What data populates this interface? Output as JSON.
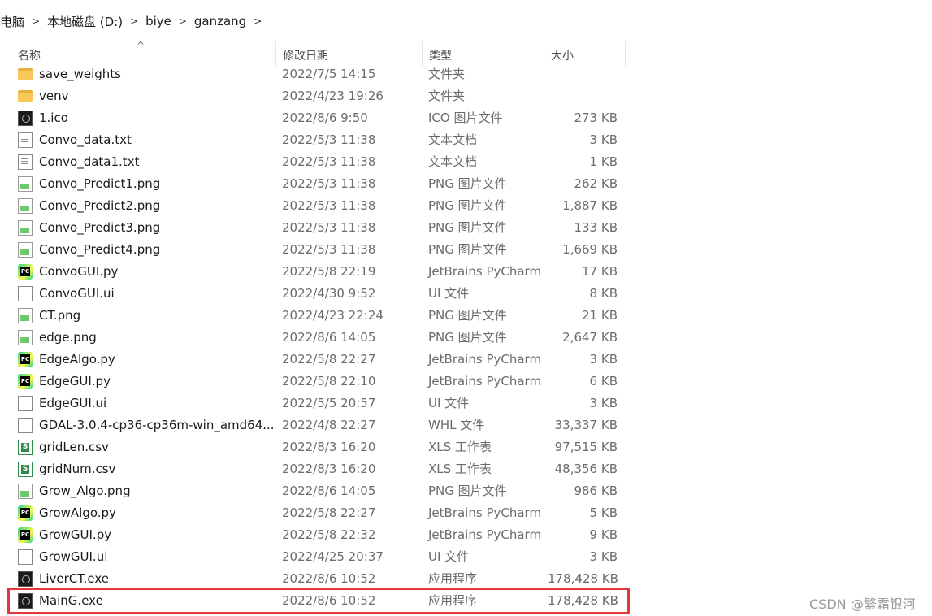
{
  "breadcrumb": {
    "items": [
      "电脑",
      "本地磁盘 (D:)",
      "biye",
      "ganzang"
    ]
  },
  "columns": {
    "name": "名称",
    "date": "修改日期",
    "type": "类型",
    "size": "大小"
  },
  "files": [
    {
      "icon": "folder-icon",
      "name": "save_weights",
      "date": "2022/7/5 14:15",
      "type": "文件夹",
      "size": ""
    },
    {
      "icon": "folder-icon",
      "name": "venv",
      "date": "2022/4/23 19:26",
      "type": "文件夹",
      "size": ""
    },
    {
      "icon": "ico-file-icon",
      "name": "1.ico",
      "date": "2022/8/6 9:50",
      "type": "ICO 图片文件",
      "size": "273 KB"
    },
    {
      "icon": "text-file-icon",
      "name": "Convo_data.txt",
      "date": "2022/5/3 11:38",
      "type": "文本文档",
      "size": "3 KB"
    },
    {
      "icon": "text-file-icon",
      "name": "Convo_data1.txt",
      "date": "2022/5/3 11:38",
      "type": "文本文档",
      "size": "1 KB"
    },
    {
      "icon": "png-file-icon",
      "name": "Convo_Predict1.png",
      "date": "2022/5/3 11:38",
      "type": "PNG 图片文件",
      "size": "262 KB"
    },
    {
      "icon": "png-file-icon",
      "name": "Convo_Predict2.png",
      "date": "2022/5/3 11:38",
      "type": "PNG 图片文件",
      "size": "1,887 KB"
    },
    {
      "icon": "png-file-icon",
      "name": "Convo_Predict3.png",
      "date": "2022/5/3 11:38",
      "type": "PNG 图片文件",
      "size": "133 KB"
    },
    {
      "icon": "png-file-icon",
      "name": "Convo_Predict4.png",
      "date": "2022/5/3 11:38",
      "type": "PNG 图片文件",
      "size": "1,669 KB"
    },
    {
      "icon": "pycharm-file-icon",
      "name": "ConvoGUI.py",
      "date": "2022/5/8 22:19",
      "type": "JetBrains PyCharm",
      "size": "17 KB"
    },
    {
      "icon": "blank-file-icon",
      "name": "ConvoGUI.ui",
      "date": "2022/4/30 9:52",
      "type": "UI 文件",
      "size": "8 KB"
    },
    {
      "icon": "png-file-icon",
      "name": "CT.png",
      "date": "2022/4/23 22:24",
      "type": "PNG 图片文件",
      "size": "21 KB"
    },
    {
      "icon": "png-file-icon",
      "name": "edge.png",
      "date": "2022/8/6 14:05",
      "type": "PNG 图片文件",
      "size": "2,647 KB"
    },
    {
      "icon": "pycharm-file-icon",
      "name": "EdgeAlgo.py",
      "date": "2022/5/8 22:27",
      "type": "JetBrains PyCharm",
      "size": "3 KB"
    },
    {
      "icon": "pycharm-file-icon",
      "name": "EdgeGUI.py",
      "date": "2022/5/8 22:10",
      "type": "JetBrains PyCharm",
      "size": "6 KB"
    },
    {
      "icon": "blank-file-icon",
      "name": "EdgeGUI.ui",
      "date": "2022/5/5 20:57",
      "type": "UI 文件",
      "size": "3 KB"
    },
    {
      "icon": "blank-file-icon",
      "name": "GDAL-3.0.4-cp36-cp36m-win_amd64...",
      "date": "2022/4/8 22:27",
      "type": "WHL 文件",
      "size": "33,337 KB"
    },
    {
      "icon": "xls-file-icon",
      "name": "gridLen.csv",
      "date": "2022/8/3 16:20",
      "type": "XLS 工作表",
      "size": "97,515 KB"
    },
    {
      "icon": "xls-file-icon",
      "name": "gridNum.csv",
      "date": "2022/8/3 16:20",
      "type": "XLS 工作表",
      "size": "48,356 KB"
    },
    {
      "icon": "png-file-icon",
      "name": "Grow_Algo.png",
      "date": "2022/8/6 14:05",
      "type": "PNG 图片文件",
      "size": "986 KB"
    },
    {
      "icon": "pycharm-file-icon",
      "name": "GrowAlgo.py",
      "date": "2022/5/8 22:27",
      "type": "JetBrains PyCharm",
      "size": "5 KB"
    },
    {
      "icon": "pycharm-file-icon",
      "name": "GrowGUI.py",
      "date": "2022/5/8 22:32",
      "type": "JetBrains PyCharm",
      "size": "9 KB"
    },
    {
      "icon": "blank-file-icon",
      "name": "GrowGUI.ui",
      "date": "2022/4/25 20:37",
      "type": "UI 文件",
      "size": "3 KB"
    },
    {
      "icon": "exe-file-icon",
      "name": "LiverCT.exe",
      "date": "2022/8/6 10:52",
      "type": "应用程序",
      "size": "178,428 KB"
    },
    {
      "icon": "exe-file-icon",
      "name": "MainG.exe",
      "date": "2022/8/6 10:52",
      "type": "应用程序",
      "size": "178,428 KB"
    }
  ],
  "highlight_color": "#e5343a",
  "watermark": "CSDN @繁霜银河"
}
